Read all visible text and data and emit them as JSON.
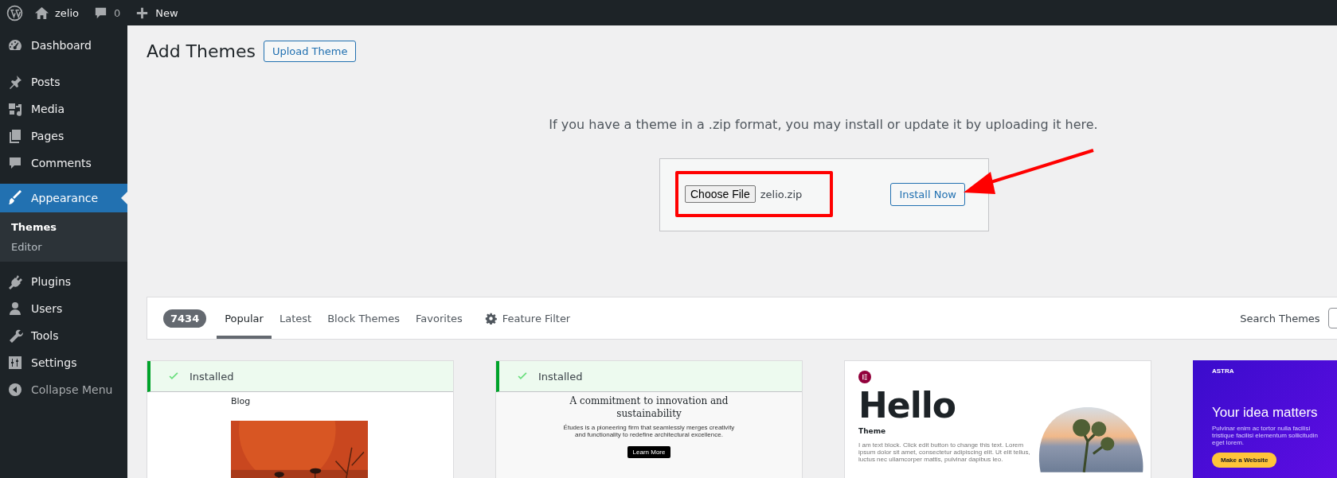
{
  "admin_bar": {
    "site": "zelio",
    "comments": "0",
    "new": "New"
  },
  "sidebar": {
    "items": [
      {
        "label": "Dashboard",
        "selected": false
      },
      {
        "label": "Posts",
        "selected": false
      },
      {
        "label": "Media",
        "selected": false
      },
      {
        "label": "Pages",
        "selected": false
      },
      {
        "label": "Comments",
        "selected": false
      },
      {
        "label": "Appearance",
        "selected": true,
        "children": [
          {
            "label": "Themes",
            "selected": true
          },
          {
            "label": "Editor",
            "selected": false
          }
        ]
      },
      {
        "label": "Plugins",
        "selected": false
      },
      {
        "label": "Users",
        "selected": false
      },
      {
        "label": "Tools",
        "selected": false
      },
      {
        "label": "Settings",
        "selected": false
      }
    ],
    "collapse": "Collapse Menu"
  },
  "header": {
    "title": "Add Themes",
    "upload_button": "Upload Theme"
  },
  "upload": {
    "description": "If you have a theme in a .zip format, you may install or update it by uploading it here.",
    "choose_button": "Choose File",
    "file_name": "zelio.zip",
    "install_button": "Install Now"
  },
  "filter_bar": {
    "count": "7434",
    "tabs": [
      {
        "label": "Popular",
        "selected": true
      },
      {
        "label": "Latest",
        "selected": false
      },
      {
        "label": "Block Themes",
        "selected": false
      },
      {
        "label": "Favorites",
        "selected": false
      }
    ],
    "feature_filter": "Feature Filter",
    "search_label": "Search Themes"
  },
  "themes": [
    {
      "installed": true,
      "installed_label": "Installed",
      "preview": {
        "kind": "blog",
        "heading": "Blog"
      }
    },
    {
      "installed": true,
      "installed_label": "Installed",
      "preview": {
        "kind": "etudes",
        "heading": "A commitment to innovation and sustainability",
        "text": "Études is a pioneering firm that seamlessly merges creativity and functionality to redefine architectural excellence.",
        "button": "Learn More"
      }
    },
    {
      "installed": false,
      "preview": {
        "kind": "hello",
        "heading": "Hello",
        "subheading": "Theme",
        "text": "I am text block. Click edit button to change this text. Lorem ipsum dolor sit amet, consectetur adipiscing elit. Ut elit tellus, luctus nec ullamcorper mattis, pulvinar dapibus leo."
      }
    },
    {
      "installed": false,
      "preview": {
        "kind": "astra",
        "brand": "ASTRA",
        "heading": "Your idea matters",
        "text": "Pulvinar enim ac tortor nulla facilisi tristique facilisi elementum sollicitudin eget lorem.",
        "button": "Make a Website"
      }
    }
  ]
}
